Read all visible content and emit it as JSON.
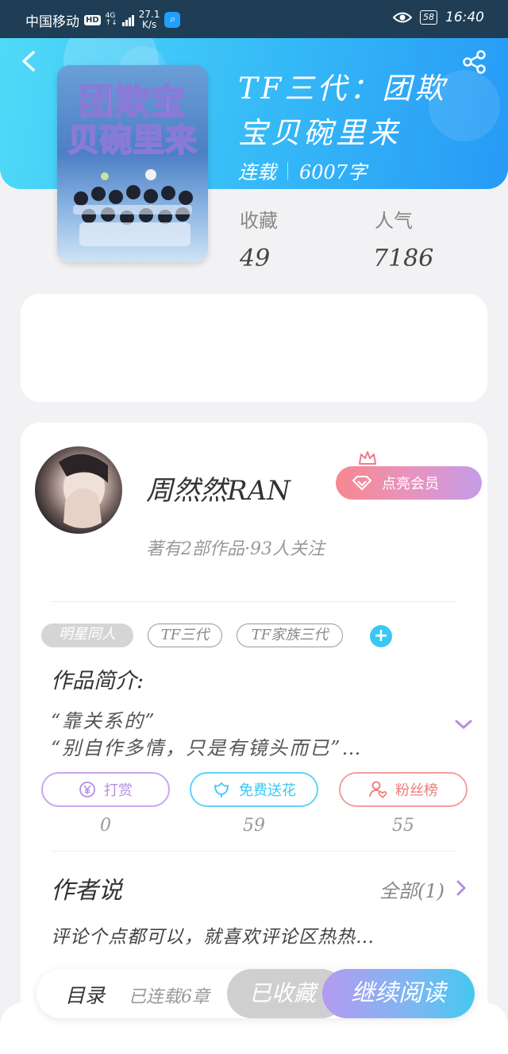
{
  "status_bar": {
    "carrier": "中国移动",
    "hd": "HD",
    "network": "4G",
    "network_sub": "↑↓",
    "speed_value": "27.1",
    "speed_unit": "K/s",
    "battery": "58",
    "time": "16:40",
    "icons": [
      "hd-badge",
      "signal-icon",
      "search-app-icon",
      "eye-icon",
      "battery-icon"
    ]
  },
  "header": {
    "back_icon": "back-arrow-icon",
    "share_icon": "share-icon",
    "accent_color": "#35b8f7"
  },
  "book": {
    "cover_title_line1": "团欺宝",
    "cover_title_line2": "贝碗里来",
    "title": "TF三代：团欺宝贝碗里来",
    "status": "连载",
    "word_count": "6007字",
    "stats": [
      {
        "label": "收藏",
        "value": "49"
      },
      {
        "label": "人气",
        "value": "7186"
      }
    ]
  },
  "author": {
    "name": "周然然RAN",
    "vip_label": "点亮会员",
    "subtitle": "著有2部作品·93人关注"
  },
  "tags": [
    "明星同人",
    "TF三代",
    "TF家族三代"
  ],
  "intro": {
    "title": "作品简介:",
    "line1": "“靠关系的”",
    "line2": "“别自作多情，只是有镜头而已”…"
  },
  "actions": [
    {
      "label": "打赏",
      "icon": "yen-icon",
      "count": "0",
      "color": "#b58ee0"
    },
    {
      "label": "免费送花",
      "icon": "flower-icon",
      "count": "59",
      "color": "#38c8f5"
    },
    {
      "label": "粉丝榜",
      "icon": "fan-heart-icon",
      "count": "55",
      "color": "#f07a7a"
    }
  ],
  "author_says": {
    "title": "作者说",
    "all_label": "全部(1)",
    "text": "评论个点都可以，就喜欢评论区热热…"
  },
  "bottom_bar": {
    "toc": "目录",
    "chapters": "已连载6章",
    "collected": "已收藏",
    "continue": "继续阅读"
  }
}
